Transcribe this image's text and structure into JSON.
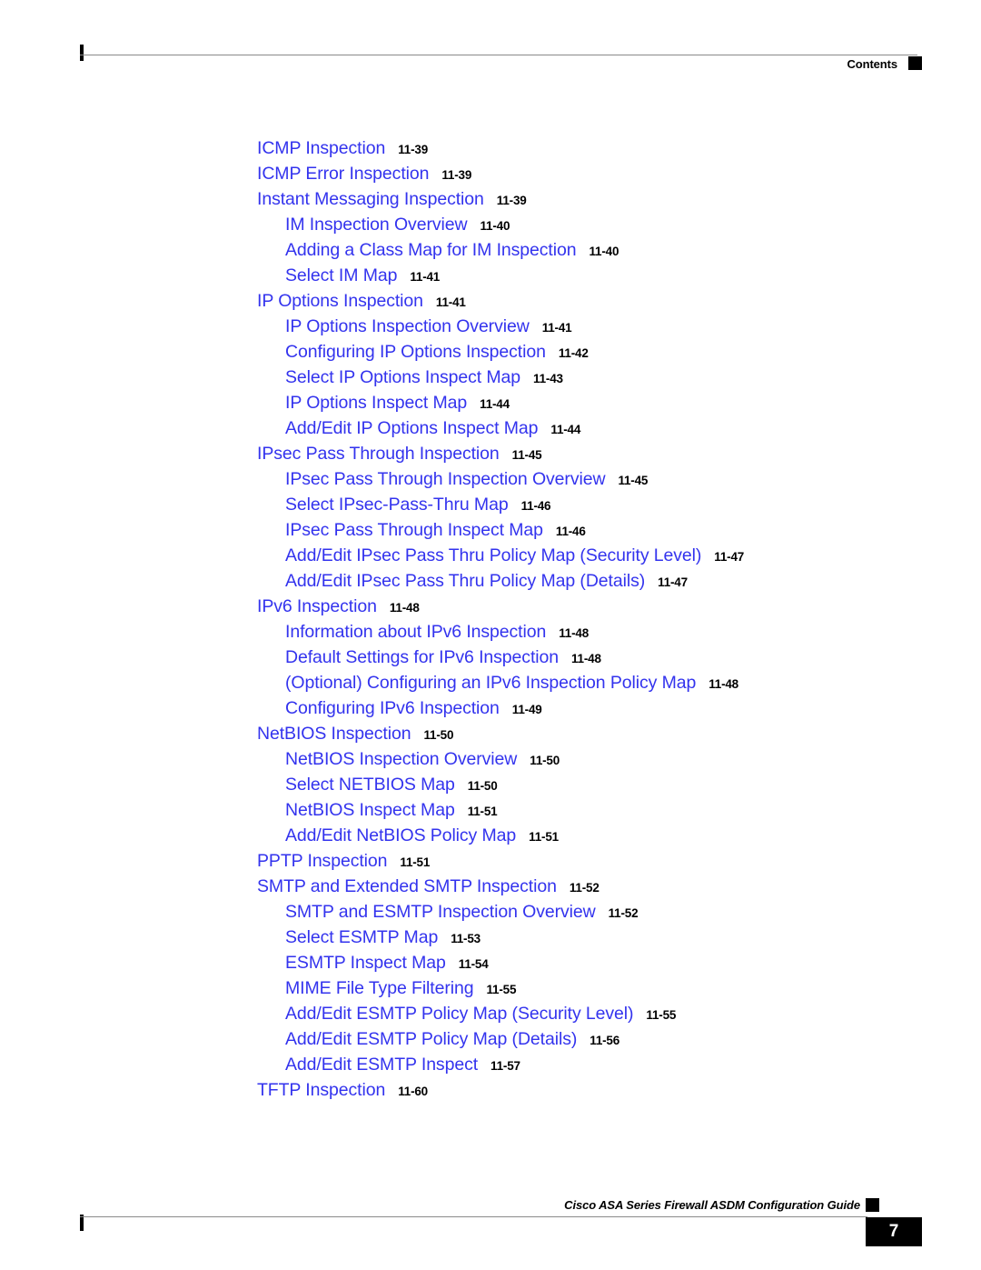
{
  "header": {
    "title": "Contents",
    "marker_icon": "black-square-marker"
  },
  "footer": {
    "guide_title": "Cisco ASA Series Firewall ASDM Configuration Guide",
    "marker_icon": "black-square-marker",
    "page_number": "7"
  },
  "colors": {
    "link": "#3333ee",
    "page_number": "#000000",
    "rule": "#8a8a8a",
    "marker": "#000000"
  },
  "toc": {
    "entries": [
      {
        "level": 1,
        "title": "ICMP Inspection",
        "page": "11-39"
      },
      {
        "level": 1,
        "title": "ICMP Error Inspection",
        "page": "11-39"
      },
      {
        "level": 1,
        "title": "Instant Messaging Inspection",
        "page": "11-39"
      },
      {
        "level": 2,
        "title": "IM Inspection Overview",
        "page": "11-40"
      },
      {
        "level": 2,
        "title": "Adding a Class Map for IM Inspection",
        "page": "11-40"
      },
      {
        "level": 2,
        "title": "Select IM Map",
        "page": "11-41"
      },
      {
        "level": 1,
        "title": "IP Options Inspection",
        "page": "11-41"
      },
      {
        "level": 2,
        "title": "IP Options Inspection Overview",
        "page": "11-41"
      },
      {
        "level": 2,
        "title": "Configuring IP Options Inspection",
        "page": "11-42"
      },
      {
        "level": 2,
        "title": "Select IP Options Inspect Map",
        "page": "11-43"
      },
      {
        "level": 2,
        "title": "IP Options Inspect Map",
        "page": "11-44"
      },
      {
        "level": 2,
        "title": "Add/Edit IP Options Inspect Map",
        "page": "11-44"
      },
      {
        "level": 1,
        "title": "IPsec Pass Through Inspection",
        "page": "11-45"
      },
      {
        "level": 2,
        "title": "IPsec Pass Through Inspection Overview",
        "page": "11-45"
      },
      {
        "level": 2,
        "title": "Select IPsec-Pass-Thru Map",
        "page": "11-46"
      },
      {
        "level": 2,
        "title": "IPsec Pass Through Inspect Map",
        "page": "11-46"
      },
      {
        "level": 2,
        "title": "Add/Edit IPsec Pass Thru Policy Map (Security Level)",
        "page": "11-47"
      },
      {
        "level": 2,
        "title": "Add/Edit IPsec Pass Thru Policy Map (Details)",
        "page": "11-47"
      },
      {
        "level": 1,
        "title": "IPv6 Inspection",
        "page": "11-48"
      },
      {
        "level": 2,
        "title": "Information about IPv6 Inspection",
        "page": "11-48"
      },
      {
        "level": 2,
        "title": "Default Settings for IPv6 Inspection",
        "page": "11-48"
      },
      {
        "level": 2,
        "title": "(Optional) Configuring an IPv6 Inspection Policy Map",
        "page": "11-48"
      },
      {
        "level": 2,
        "title": "Configuring IPv6 Inspection",
        "page": "11-49"
      },
      {
        "level": 1,
        "title": "NetBIOS Inspection",
        "page": "11-50"
      },
      {
        "level": 2,
        "title": "NetBIOS Inspection Overview",
        "page": "11-50"
      },
      {
        "level": 2,
        "title": "Select NETBIOS Map",
        "page": "11-50"
      },
      {
        "level": 2,
        "title": "NetBIOS Inspect Map",
        "page": "11-51"
      },
      {
        "level": 2,
        "title": "Add/Edit NetBIOS Policy Map",
        "page": "11-51"
      },
      {
        "level": 1,
        "title": "PPTP Inspection",
        "page": "11-51"
      },
      {
        "level": 1,
        "title": "SMTP and Extended SMTP Inspection",
        "page": "11-52"
      },
      {
        "level": 2,
        "title": "SMTP and ESMTP Inspection Overview",
        "page": "11-52"
      },
      {
        "level": 2,
        "title": "Select ESMTP Map",
        "page": "11-53"
      },
      {
        "level": 2,
        "title": "ESMTP Inspect Map",
        "page": "11-54"
      },
      {
        "level": 2,
        "title": "MIME File Type Filtering",
        "page": "11-55"
      },
      {
        "level": 2,
        "title": "Add/Edit ESMTP Policy Map (Security Level)",
        "page": "11-55"
      },
      {
        "level": 2,
        "title": "Add/Edit ESMTP Policy Map (Details)",
        "page": "11-56"
      },
      {
        "level": 2,
        "title": "Add/Edit ESMTP Inspect",
        "page": "11-57"
      },
      {
        "level": 1,
        "title": "TFTP Inspection",
        "page": "11-60"
      }
    ]
  }
}
